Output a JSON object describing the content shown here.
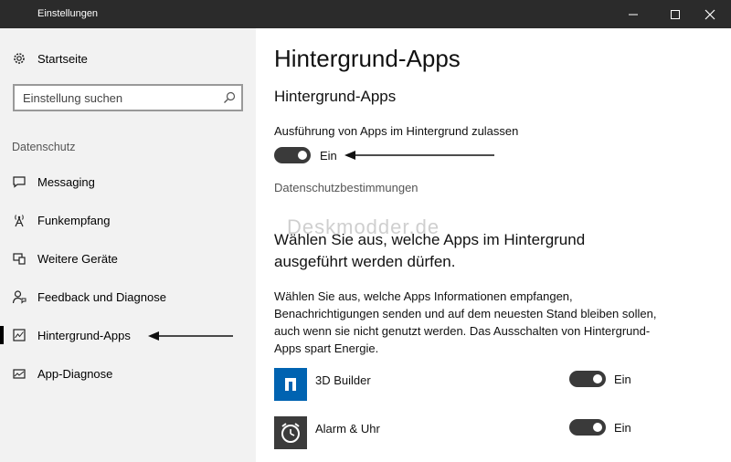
{
  "window": {
    "title": "Einstellungen",
    "controls": {
      "minimize": "minimize-icon",
      "maximize": "maximize-icon",
      "close": "close-icon"
    }
  },
  "sidebar": {
    "home_label": "Startseite",
    "search_placeholder": "Einstellung suchen",
    "section_label": "Datenschutz",
    "items": [
      {
        "label": "Messaging",
        "icon": "message-icon"
      },
      {
        "label": "Funkempfang",
        "icon": "antenna-icon"
      },
      {
        "label": "Weitere Geräte",
        "icon": "devices-icon"
      },
      {
        "label": "Feedback und Diagnose",
        "icon": "feedback-icon"
      },
      {
        "label": "Hintergrund-Apps",
        "icon": "background-apps-icon",
        "active": true
      },
      {
        "label": "App-Diagnose",
        "icon": "diagnostics-icon"
      }
    ]
  },
  "main": {
    "page_title": "Hintergrund-Apps",
    "section_title": "Hintergrund-Apps",
    "toggle_label": "Ausführung von Apps im Hintergrund zulassen",
    "toggle_state": "Ein",
    "privacy_link": "Datenschutzbestimmungen",
    "watermark": "Deskmodder.de",
    "choose_heading": "Wählen Sie aus, welche Apps im Hintergrund ausgeführt werden dürfen.",
    "description": "Wählen Sie aus, welche Apps Informationen empfangen, Benachrichtigungen senden und auf dem neuesten Stand bleiben sollen, auch wenn sie nicht genutzt werden. Das Ausschalten von Hintergrund-Apps spart Energie.",
    "apps": [
      {
        "name": "3D Builder",
        "state": "Ein",
        "icon": "3d-builder-icon",
        "color": "#0063b1"
      },
      {
        "name": "Alarm & Uhr",
        "state": "Ein",
        "icon": "alarm-clock-icon",
        "color": "#3b3b3b"
      }
    ]
  },
  "colors": {
    "toggle_on": "#3a3a3a",
    "sidebar_bg": "#f2f2f2",
    "titlebar_bg": "#2b2b2b"
  }
}
